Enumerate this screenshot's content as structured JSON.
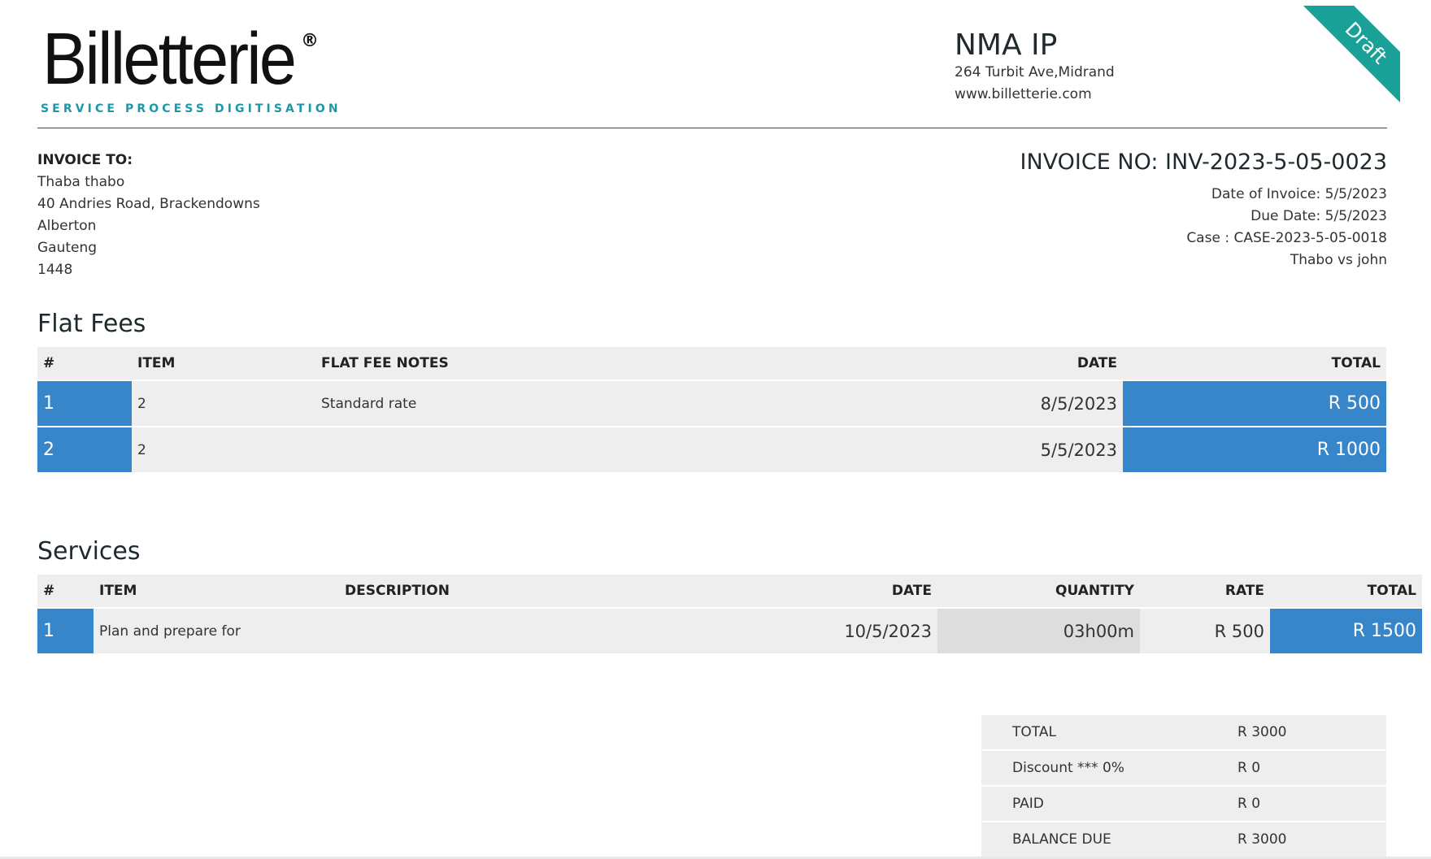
{
  "logo": {
    "wordmark": "Billetterie",
    "registered": "®",
    "tagline": "SERVICE PROCESS DIGITISATION",
    "brand_color": "#1a98a6"
  },
  "company": {
    "name": "NMA IP",
    "address": "264 Turbit Ave,Midrand",
    "website": "www.billetterie.com"
  },
  "status_ribbon": {
    "label": "Draft",
    "color": "#1aa197"
  },
  "bill_to": {
    "label": "INVOICE TO:",
    "lines": [
      "Thaba thabo",
      "40 Andries Road, Brackendowns",
      "Alberton",
      "Gauteng",
      "1448"
    ]
  },
  "invoice": {
    "number": "INVOICE NO: INV-2023-5-05-0023",
    "date_of_invoice": "Date of Invoice: 5/5/2023",
    "due_date": "Due Date: 5/5/2023",
    "case": "Case : CASE-2023-5-05-0018",
    "case_title": "Thabo vs john"
  },
  "flat_fees": {
    "title": "Flat Fees",
    "columns": [
      "#",
      "ITEM",
      "FLAT FEE NOTES",
      "DATE",
      "TOTAL"
    ],
    "rows": [
      {
        "num": "1",
        "item": "2",
        "notes": "Standard rate",
        "date": "8/5/2023",
        "total": "R 500"
      },
      {
        "num": "2",
        "item": "2",
        "notes": "",
        "date": "5/5/2023",
        "total": "R 1000"
      }
    ]
  },
  "services": {
    "title": "Services",
    "columns": [
      "#",
      "ITEM",
      "DESCRIPTION",
      "DATE",
      "QUANTITY",
      "RATE",
      "TOTAL"
    ],
    "rows": [
      {
        "num": "1",
        "item": "Plan and prepare for",
        "description": "",
        "date": "10/5/2023",
        "quantity": "03h00m",
        "rate": "R 500",
        "total": "R 1500"
      }
    ]
  },
  "summary": [
    {
      "label": "TOTAL",
      "value": "R 3000"
    },
    {
      "label": "Discount *** 0%",
      "value": "R 0"
    },
    {
      "label": "PAID",
      "value": "R 0"
    },
    {
      "label": "BALANCE DUE",
      "value": "R 3000"
    }
  ],
  "colors": {
    "accent_blue": "#3686c9",
    "row_gray": "#eeeeee"
  }
}
